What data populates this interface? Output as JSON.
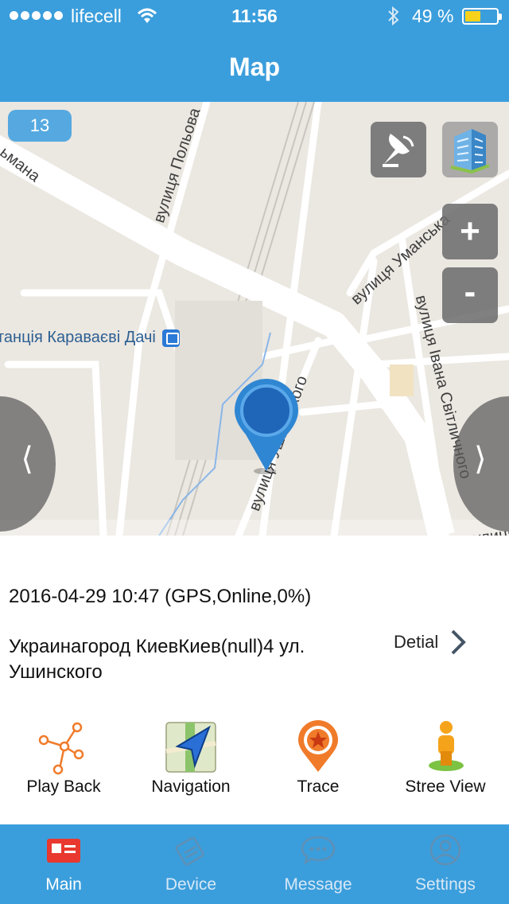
{
  "status_bar": {
    "carrier": "lifecell",
    "time": "11:56",
    "battery_text": "49 %",
    "battery_level": 0.49
  },
  "header": {
    "title": "Map"
  },
  "map": {
    "zoom_level": "13",
    "zoom_in_label": "+",
    "zoom_out_label": "-",
    "prev_label": "⟨",
    "next_label": "⟩",
    "station": "танція Караваєві Дачі",
    "streets": {
      "polova": "вулиця Польова",
      "umanska": "вулиця Уманська",
      "svitlychnoho": "вулиця Івана Світличного",
      "top_left": "ьмана",
      "ushynskoho": "вулиця Ушинського",
      "bottom_right": "вулиця"
    }
  },
  "info": {
    "datetime": "2016-04-29 10:47 (GPS,Online,0%)",
    "address": "Украинагород КиевКиев(null)4 ул. Ушинского",
    "detail_label": "Detial"
  },
  "actions": [
    {
      "label": "Play Back",
      "icon": "playback-route-icon"
    },
    {
      "label": "Navigation",
      "icon": "navigation-arrow-icon"
    },
    {
      "label": "Trace",
      "icon": "trace-star-pin-icon"
    },
    {
      "label": "Stree View",
      "icon": "street-view-person-icon"
    }
  ],
  "tabs": [
    {
      "label": "Main",
      "icon": "id-card-icon",
      "active": true
    },
    {
      "label": "Device",
      "icon": "device-tag-icon",
      "active": false
    },
    {
      "label": "Message",
      "icon": "chat-bubble-icon",
      "active": false
    },
    {
      "label": "Settings",
      "icon": "user-settings-icon",
      "active": false
    }
  ],
  "colors": {
    "header_bg": "#3b9edc",
    "tab_active_icon": "#e8382f",
    "accent_orange": "#f07b2a",
    "map_bg": "#ebe7e1"
  }
}
